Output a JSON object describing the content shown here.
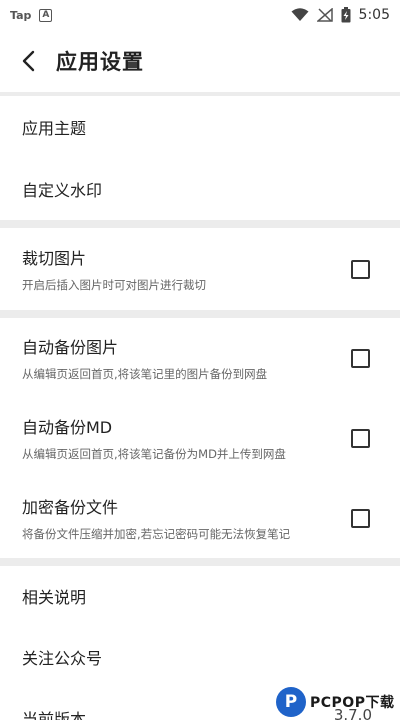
{
  "status_bar": {
    "app_label": "Tap",
    "a_label": "A",
    "time": "5:05"
  },
  "app_bar": {
    "title": "应用设置"
  },
  "groups": [
    {
      "items": [
        {
          "title": "应用主题"
        },
        {
          "title": "自定义水印"
        }
      ]
    },
    {
      "items": [
        {
          "title": "裁切图片",
          "subtitle": "开启后插入图片时可对图片进行裁切",
          "checked": false
        }
      ]
    },
    {
      "items": [
        {
          "title": "自动备份图片",
          "subtitle": "从编辑页返回首页,将该笔记里的图片备份到网盘",
          "checked": false
        },
        {
          "title": "自动备份MD",
          "subtitle": "从编辑页返回首页,将该笔记备份为MD并上传到网盘",
          "checked": false
        },
        {
          "title": "加密备份文件",
          "subtitle": "将备份文件压缩并加密,若忘记密码可能无法恢复笔记",
          "checked": false
        }
      ]
    },
    {
      "items": [
        {
          "title": "相关说明"
        },
        {
          "title": "关注公众号"
        },
        {
          "title": "当前版本",
          "value": "3.7.0"
        }
      ]
    }
  ],
  "watermark": {
    "logo_letter": "P",
    "text": "PCPOP下载"
  }
}
